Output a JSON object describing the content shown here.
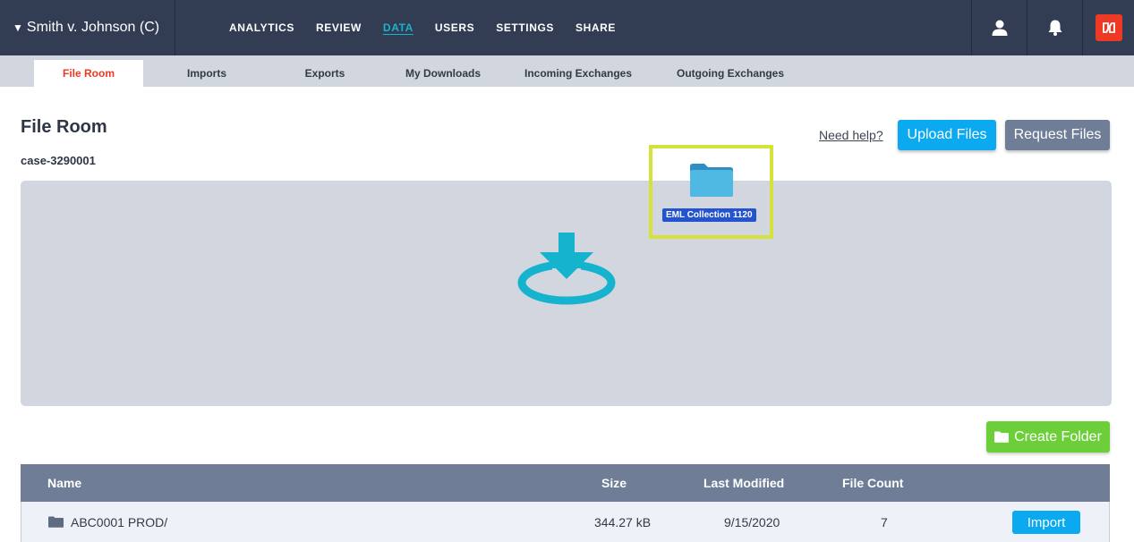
{
  "header": {
    "case_title": "Smith v. Johnson (C)",
    "nav": [
      "ANALYTICS",
      "REVIEW",
      "DATA",
      "USERS",
      "SETTINGS",
      "SHARE"
    ],
    "active_nav": "DATA"
  },
  "subtabs": [
    "File Room",
    "Imports",
    "Exports",
    "My Downloads",
    "Incoming Exchanges",
    "Outgoing Exchanges"
  ],
  "active_subtab": "File Room",
  "page": {
    "title": "File Room",
    "case_id": "case-3290001",
    "help_link": "Need help?",
    "upload_label": "Upload Files",
    "request_label": "Request Files",
    "create_folder_label": "Create Folder"
  },
  "drag_preview": {
    "label": "EML Collection 1120"
  },
  "table": {
    "columns": [
      "Name",
      "Size",
      "Last Modified",
      "File Count"
    ],
    "rows": [
      {
        "name": "ABC0001 PROD/",
        "size": "344.27 kB",
        "modified": "9/15/2020",
        "count": "7",
        "action": "Import"
      }
    ]
  },
  "colors": {
    "topbar": "#323d54",
    "accent": "#16b3cf",
    "active_tab": "#ee3a24",
    "primary_button": "#0aa9f0",
    "secondary_button": "#6f7d96",
    "create_button": "#6ccf3a",
    "highlight": "#d4e23a",
    "drag_label": "#2353cf"
  }
}
